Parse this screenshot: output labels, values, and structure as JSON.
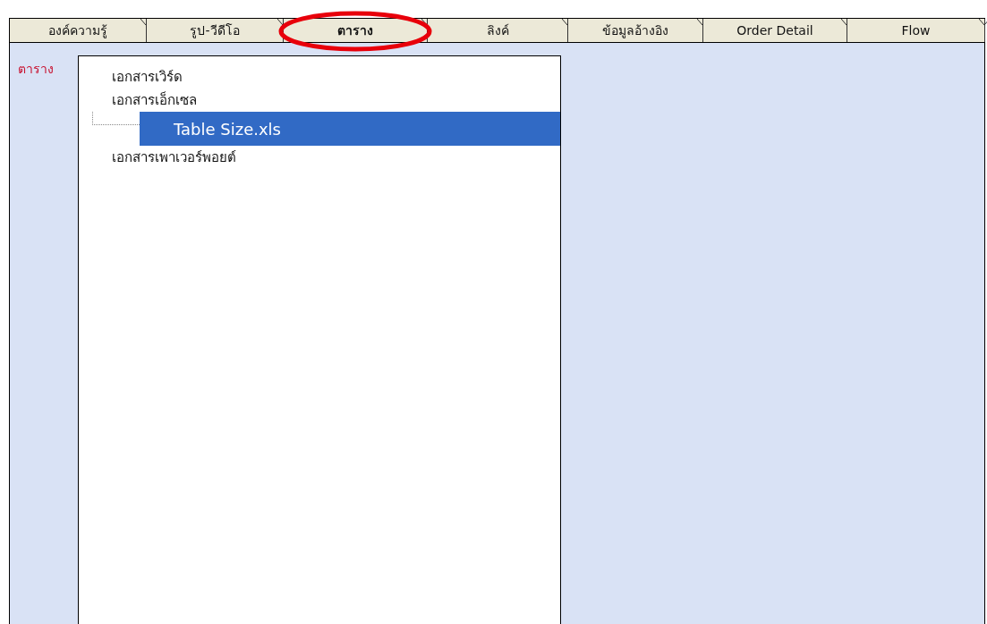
{
  "tabs": [
    {
      "label": "องค์ความรู้",
      "selected": false,
      "circled": false
    },
    {
      "label": "รูป-วีดีโอ",
      "selected": false,
      "circled": false
    },
    {
      "label": "ตาราง",
      "selected": true,
      "circled": true
    },
    {
      "label": "ลิงค์",
      "selected": false,
      "circled": false
    },
    {
      "label": "ข้อมูลอ้างอิง",
      "selected": false,
      "circled": false
    },
    {
      "label": "Order Detail",
      "selected": false,
      "circled": false
    },
    {
      "label": "Flow",
      "selected": false,
      "circled": false
    }
  ],
  "panel": {
    "label": "ตาราง",
    "tree": [
      {
        "label": "เอกสารเวิร์ด",
        "selected": false
      },
      {
        "label": "เอกสารเอ็กเซล",
        "selected": false,
        "children": [
          {
            "label": "Table Size.xls",
            "selected": true
          }
        ]
      },
      {
        "label": "เอกสารเพาเวอร์พอยต์",
        "selected": false
      }
    ]
  }
}
